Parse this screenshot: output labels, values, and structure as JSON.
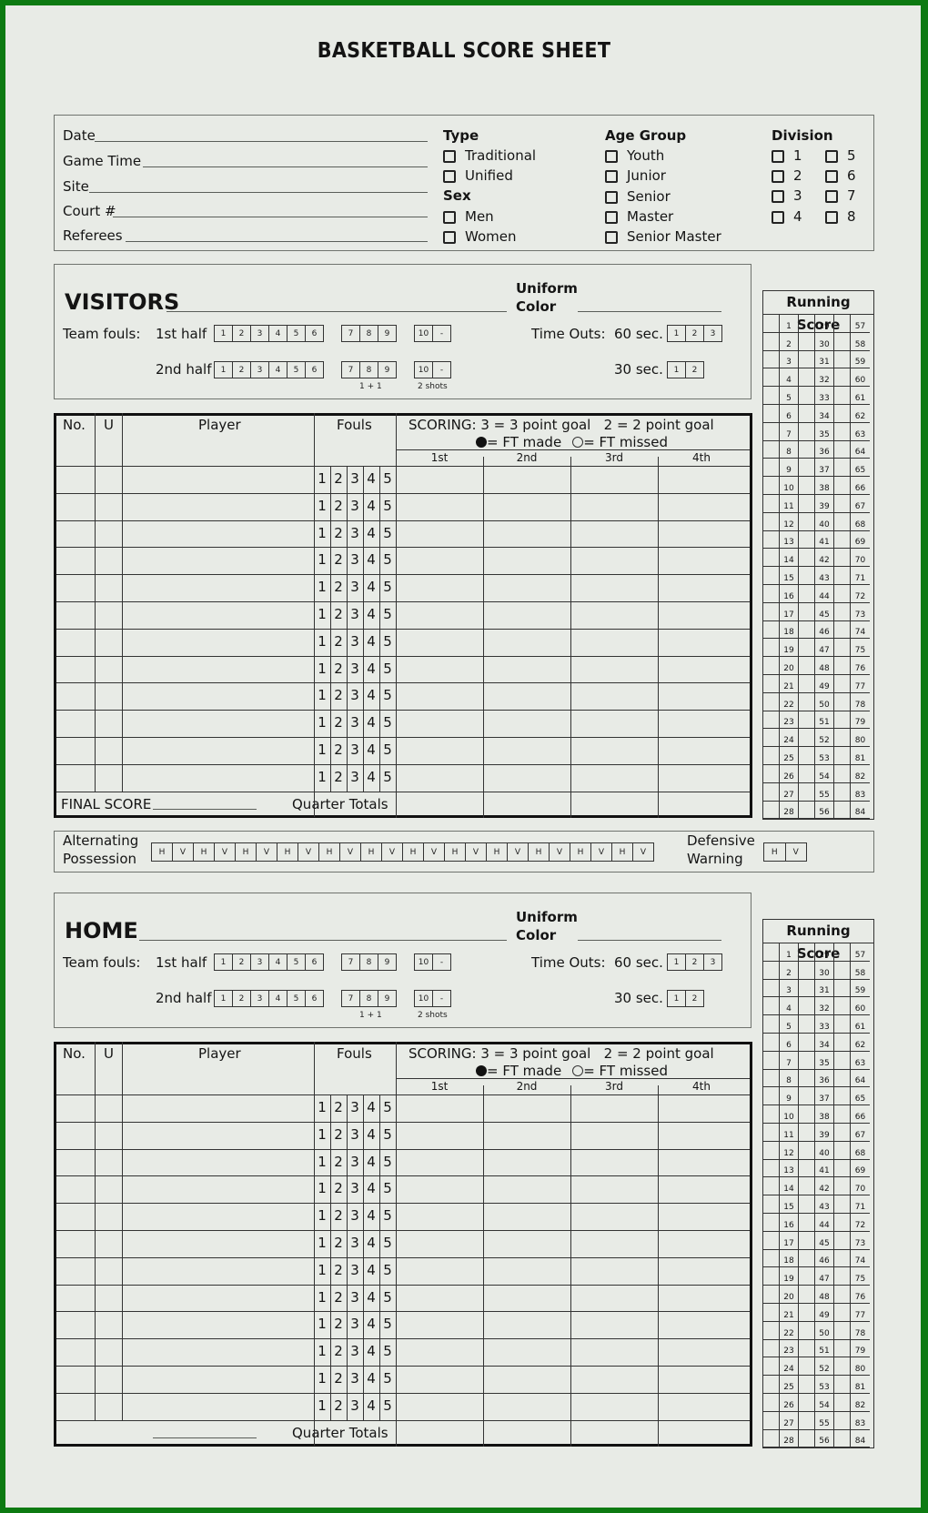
{
  "title": "BASKETBALL SCORE SHEET",
  "info": {
    "fields": [
      {
        "label": "Date",
        "value": ""
      },
      {
        "label": "Game Time",
        "value": ""
      },
      {
        "label": "Site",
        "value": ""
      },
      {
        "label": "Court #",
        "value": ""
      },
      {
        "label": "Referees",
        "value": ""
      }
    ],
    "type": {
      "heading": "Type",
      "options": [
        "Traditional",
        "Unified"
      ]
    },
    "sex": {
      "heading": "Sex",
      "options": [
        "Men",
        "Women"
      ]
    },
    "age_group": {
      "heading": "Age Group",
      "options": [
        "Youth",
        "Junior",
        "Senior",
        "Master",
        "Senior Master"
      ]
    },
    "division": {
      "heading": "Division",
      "options": [
        "1",
        "2",
        "3",
        "4",
        "5",
        "6",
        "7",
        "8"
      ]
    }
  },
  "team_header": {
    "uniform_label_1": "Uniform",
    "uniform_label_2": "Color",
    "team_fouls_label": "Team fouls:",
    "first_half_label": "1st half",
    "second_half_label": "2nd half",
    "fouls_a": [
      "1",
      "2",
      "3",
      "4",
      "5",
      "6"
    ],
    "fouls_b": [
      "7",
      "8",
      "9"
    ],
    "fouls_c": [
      "10",
      "-"
    ],
    "note_b": "1 + 1",
    "note_c": "2 shots",
    "timeouts_label": "Time Outs:",
    "sixty_label": "60 sec.",
    "thirty_label": "30 sec.",
    "timeouts_60": [
      "1",
      "2",
      "3"
    ],
    "timeouts_30": [
      "1",
      "2"
    ]
  },
  "visitors": {
    "name": "VISITORS",
    "team_value": "",
    "uniform_color": ""
  },
  "home": {
    "name": "HOME",
    "team_value": "",
    "uniform_color": ""
  },
  "table": {
    "col_no": "No.",
    "col_u": "U",
    "col_player": "Player",
    "col_fouls": "Fouls",
    "scoring_line1": "SCORING: 3 = 3 point goal   2 = 2 point goal",
    "ft_made": "= FT made",
    "ft_missed": "= FT missed",
    "quarters": [
      "1st",
      "2nd",
      "3rd",
      "4th"
    ],
    "foul_numbers": [
      "1",
      "2",
      "3",
      "4",
      "5"
    ],
    "row_count": 12,
    "final_score_label": "FINAL SCORE",
    "quarter_totals_label": "Quarter Totals"
  },
  "running_score": {
    "title": "Running Score",
    "columns": [
      [
        "1",
        "2",
        "3",
        "4",
        "5",
        "6",
        "7",
        "8",
        "9",
        "10",
        "11",
        "12",
        "13",
        "14",
        "15",
        "16",
        "17",
        "18",
        "19",
        "20",
        "21",
        "22",
        "23",
        "24",
        "25",
        "26",
        "27",
        "28"
      ],
      [
        "29",
        "30",
        "31",
        "32",
        "33",
        "34",
        "35",
        "36",
        "37",
        "38",
        "39",
        "40",
        "41",
        "42",
        "43",
        "44",
        "45",
        "46",
        "47",
        "48",
        "49",
        "50",
        "51",
        "52",
        "53",
        "54",
        "55",
        "56"
      ],
      [
        "57",
        "58",
        "59",
        "60",
        "61",
        "62",
        "63",
        "64",
        "65",
        "66",
        "67",
        "68",
        "69",
        "70",
        "71",
        "72",
        "73",
        "74",
        "75",
        "76",
        "77",
        "78",
        "79",
        "80",
        "81",
        "82",
        "83",
        "84"
      ]
    ]
  },
  "possession": {
    "label_1": "Alternating",
    "label_2": "Possession",
    "boxes": [
      "H",
      "V",
      "H",
      "V",
      "H",
      "V",
      "H",
      "V",
      "H",
      "V",
      "H",
      "V",
      "H",
      "V",
      "H",
      "V",
      "H",
      "V",
      "H",
      "V",
      "H",
      "V",
      "H",
      "V"
    ],
    "warning_label_1": "Defensive",
    "warning_label_2": "Warning",
    "warning_boxes": [
      "H",
      "V"
    ]
  },
  "colors": {
    "border_green": "#0d7a12",
    "paper": "#e8ebe6",
    "ink": "#141414"
  }
}
